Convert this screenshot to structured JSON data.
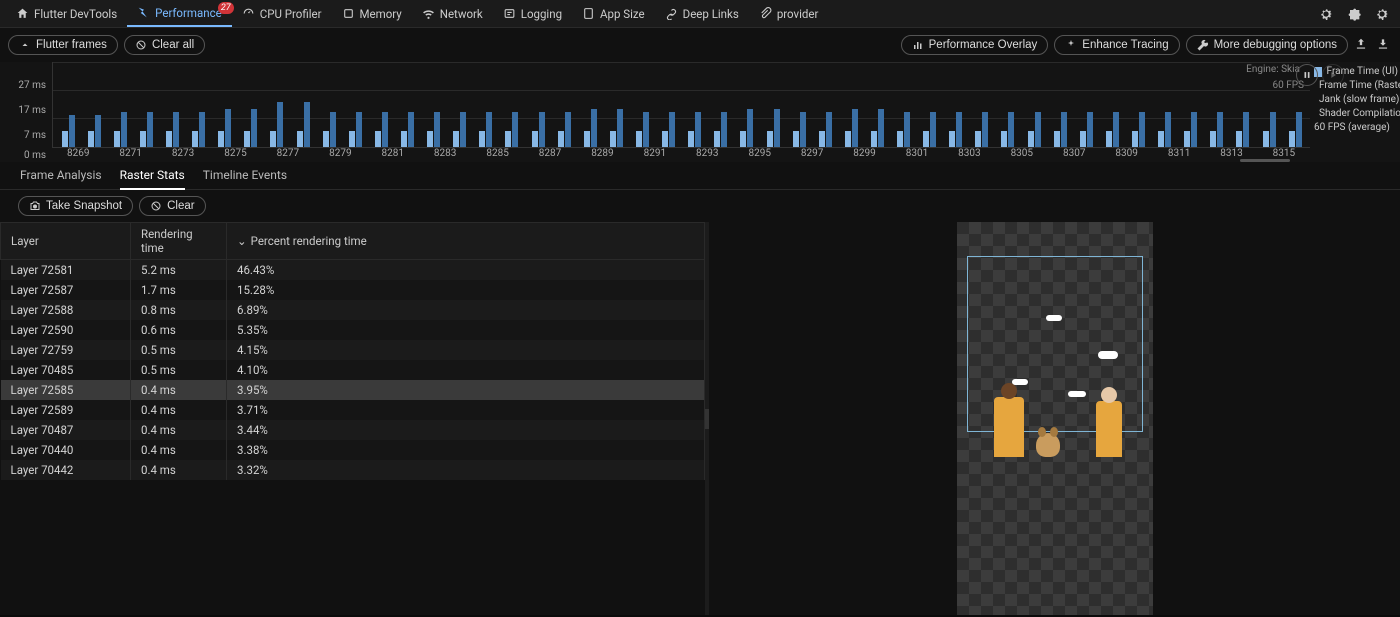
{
  "topnav": {
    "home": "Flutter DevTools",
    "tabs": [
      "Performance",
      "CPU Profiler",
      "Memory",
      "Network",
      "Logging",
      "App Size",
      "Deep Links",
      "provider"
    ],
    "badge": "27"
  },
  "toolbar": {
    "flutter_frames": "Flutter frames",
    "clear_all": "Clear all",
    "perf_overlay": "Performance Overlay",
    "enhance_tracing": "Enhance Tracing",
    "more_debug": "More debugging options"
  },
  "chart": {
    "engine": "Engine: Skia",
    "fps_label": "60 FPS",
    "fps_avg": "60 FPS (average)",
    "y_labels": [
      "27 ms",
      "17 ms",
      "7 ms",
      "0 ms"
    ],
    "legend": [
      {
        "color": "#88b8e6",
        "label": "Frame Time (UI)"
      },
      {
        "color": "#3a6fa5",
        "label": "Frame Time (Raster)"
      },
      {
        "color": "#e29071",
        "label": "Jank (slow frame)"
      },
      {
        "color": "#a43a58",
        "label": "Shader Compilation"
      }
    ]
  },
  "chart_data": {
    "type": "bar",
    "title": "",
    "xlabel": "",
    "ylabel": "ms",
    "ylim": [
      0,
      27
    ],
    "categories": [
      "8269",
      "8271",
      "8273",
      "8275",
      "8277",
      "8279",
      "8281",
      "8283",
      "8285",
      "8287",
      "8289",
      "8291",
      "8293",
      "8295",
      "8297",
      "8299",
      "8301",
      "8303",
      "8305",
      "8307",
      "8309",
      "8311",
      "8313",
      "8315"
    ],
    "series": [
      {
        "name": "Frame Time (UI)",
        "values": [
          5,
          5,
          5,
          5,
          5,
          5,
          5,
          5,
          5,
          5,
          5,
          5,
          5,
          5,
          5,
          5,
          5,
          5,
          5,
          5,
          5,
          5,
          5,
          5
        ]
      },
      {
        "name": "Frame Time (Raster)",
        "values": [
          10,
          11,
          11,
          12,
          14,
          11,
          11,
          11,
          11,
          11,
          12,
          11,
          11,
          12,
          11,
          12,
          11,
          11,
          11,
          11,
          11,
          11,
          11,
          11
        ]
      }
    ]
  },
  "subtabs": [
    "Frame Analysis",
    "Raster Stats",
    "Timeline Events"
  ],
  "actions": {
    "take_snapshot": "Take Snapshot",
    "clear": "Clear"
  },
  "table": {
    "headers": [
      "Layer",
      "Rendering time",
      "Percent rendering time"
    ],
    "rows": [
      {
        "layer": "Layer 72581",
        "time": "5.2 ms",
        "pct": "46.43%"
      },
      {
        "layer": "Layer 72587",
        "time": "1.7 ms",
        "pct": "15.28%"
      },
      {
        "layer": "Layer 72588",
        "time": "0.8 ms",
        "pct": "6.89%"
      },
      {
        "layer": "Layer 72590",
        "time": "0.6 ms",
        "pct": "5.35%"
      },
      {
        "layer": "Layer 72759",
        "time": "0.5 ms",
        "pct": "4.15%"
      },
      {
        "layer": "Layer 70485",
        "time": "0.5 ms",
        "pct": "4.10%"
      },
      {
        "layer": "Layer 72585",
        "time": "0.4 ms",
        "pct": "3.95%",
        "selected": true
      },
      {
        "layer": "Layer 72589",
        "time": "0.4 ms",
        "pct": "3.71%"
      },
      {
        "layer": "Layer 70487",
        "time": "0.4 ms",
        "pct": "3.44%"
      },
      {
        "layer": "Layer 70440",
        "time": "0.4 ms",
        "pct": "3.38%"
      },
      {
        "layer": "Layer 70442",
        "time": "0.4 ms",
        "pct": "3.32%"
      }
    ]
  }
}
